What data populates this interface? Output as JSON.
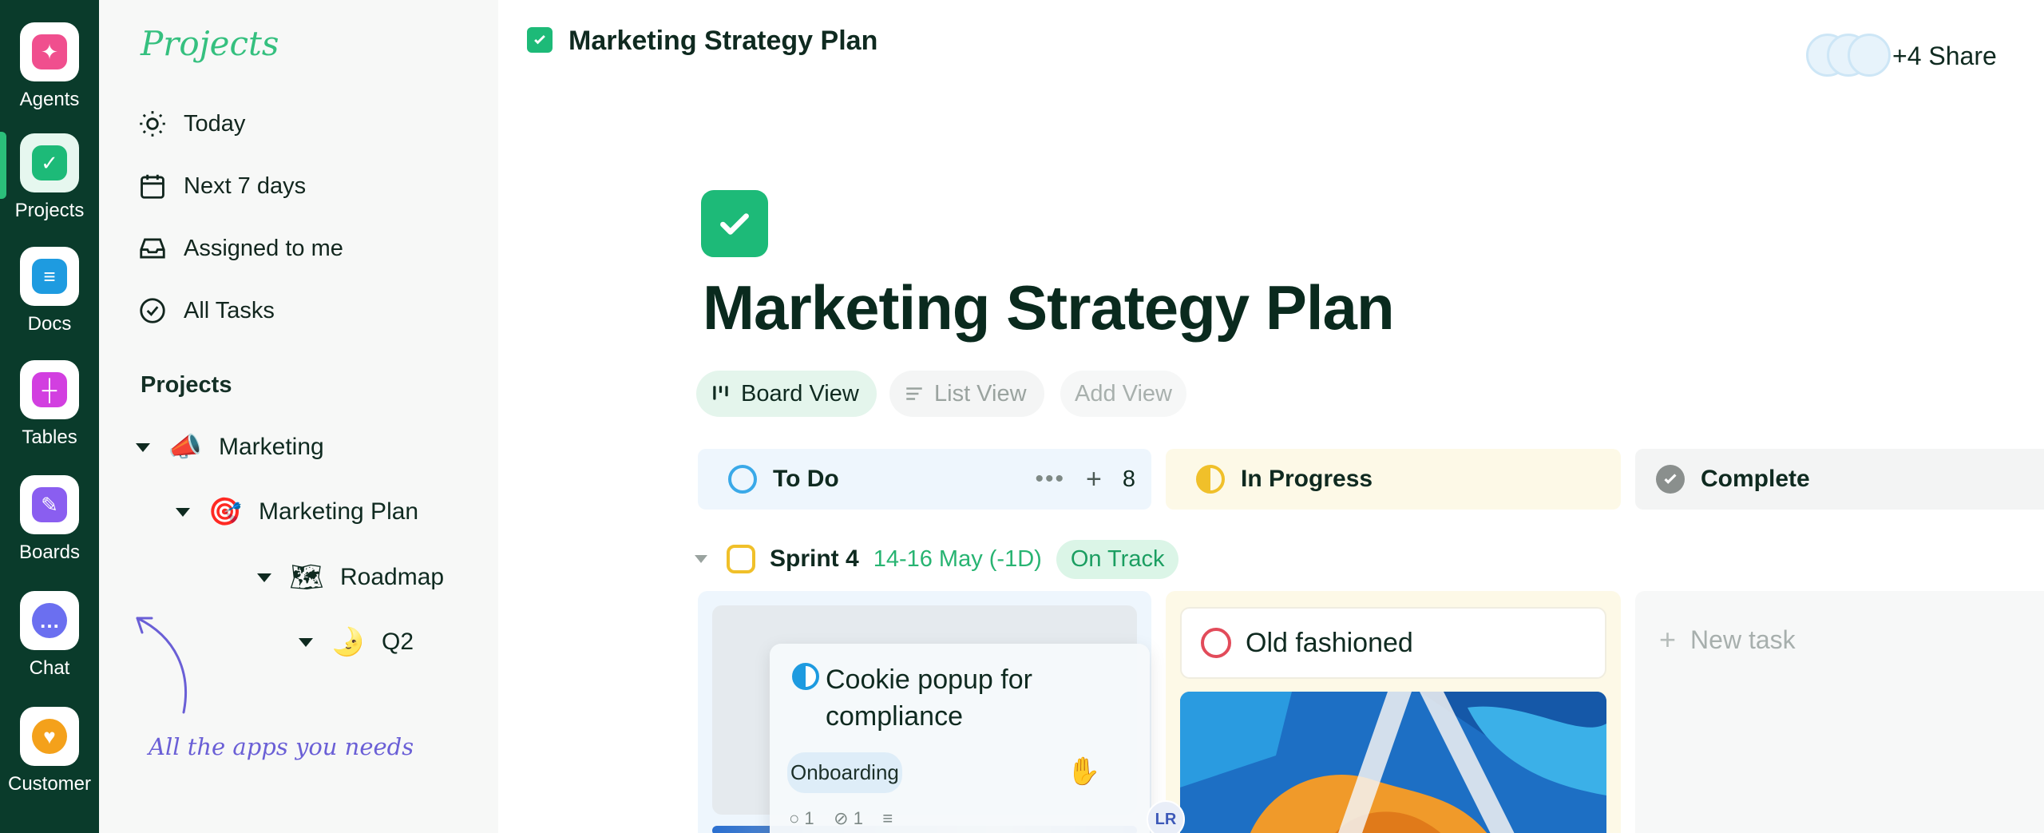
{
  "rail": {
    "items": [
      {
        "label": "Agents",
        "icon": "sparkle-icon",
        "color": "#f04f8e",
        "glyph": "✦"
      },
      {
        "label": "Projects",
        "icon": "check-icon",
        "color": "#1dba78",
        "glyph": "✓"
      },
      {
        "label": "Docs",
        "icon": "doc-icon",
        "color": "#1e9be0",
        "glyph": "≡"
      },
      {
        "label": "Tables",
        "icon": "table-icon",
        "color": "#d23fe0",
        "glyph": "┼"
      },
      {
        "label": "Boards",
        "icon": "board-icon",
        "color": "#8a5ef0",
        "glyph": "✎"
      },
      {
        "label": "Chat",
        "icon": "chat-icon",
        "color": "#6b6ff0",
        "glyph": "…"
      },
      {
        "label": "Customer",
        "icon": "heart-icon",
        "color": "#f4a11b",
        "glyph": "♥"
      }
    ]
  },
  "sidebar": {
    "title": "Projects",
    "nav": [
      {
        "label": "Today",
        "icon": "sun-icon"
      },
      {
        "label": "Next 7 days",
        "icon": "calendar-icon"
      },
      {
        "label": "Assigned to me",
        "icon": "inbox-icon"
      },
      {
        "label": "All Tasks",
        "icon": "check-circle-icon"
      }
    ],
    "section_label": "Projects",
    "tree": [
      {
        "label": "Marketing",
        "emoji": "📣"
      },
      {
        "label": "Marketing Plan",
        "emoji": "🎯"
      },
      {
        "label": "Roadmap",
        "emoji": "🗺"
      },
      {
        "label": "Q2",
        "emoji": "🌛"
      }
    ],
    "note": "All the apps you needs"
  },
  "topbar": {
    "title": "Marketing Strategy Plan",
    "share": "+4 Share"
  },
  "page": {
    "title": "Marketing Strategy Plan",
    "views": [
      "Board View",
      "List View",
      "Add View"
    ]
  },
  "columns": {
    "todo": {
      "label": "To Do",
      "count": "8",
      "color": "#3aa9e8"
    },
    "progress": {
      "label": "In Progress",
      "color": "#f0c02a"
    },
    "complete": {
      "label": "Complete",
      "color": "#8a8f8d"
    }
  },
  "sprint": {
    "name": "Sprint 4",
    "dates": "14-16 May (-1D)",
    "status": "On Track"
  },
  "cards": {
    "dragging": {
      "title": "Cookie popup for compliance",
      "tag": "Onboarding",
      "comments": "1",
      "attachments": "1"
    },
    "progress_card": {
      "title": "Old fashioned"
    },
    "assignee_initials": "LR"
  },
  "new_task": "New task"
}
